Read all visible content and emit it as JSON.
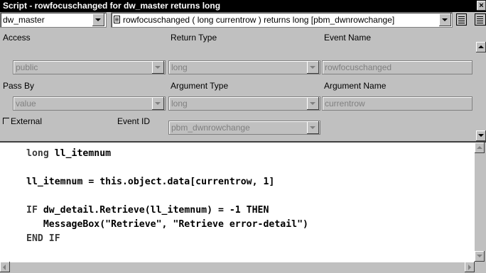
{
  "window": {
    "title": "Script - rowfocuschanged for dw_master returns long",
    "close_glyph": "×"
  },
  "toolbar": {
    "object_combo": "dw_master",
    "event_combo": "rowfocuschanged ( long currentrow )  returns long [pbm_dwnrowchange]"
  },
  "properties": {
    "access_label": "Access",
    "access_value": "public",
    "return_type_label": "Return Type",
    "return_type_value": "long",
    "event_name_label": "Event Name",
    "event_name_value": "rowfocuschanged",
    "pass_by_label": "Pass By",
    "pass_by_value": "value",
    "argument_type_label": "Argument Type",
    "argument_type_value": "long",
    "argument_name_label": "Argument Name",
    "argument_name_value": "currentrow",
    "external_label": "External",
    "event_id_label": "Event ID",
    "event_id_value": "pbm_dwnrowchange"
  },
  "script": {
    "lines": [
      {
        "kw": "long",
        "rest": " ll_itemnum"
      },
      {
        "kw": "",
        "rest": ""
      },
      {
        "kw": "",
        "rest": "ll_itemnum = this.object.data[currentrow, 1]"
      },
      {
        "kw": "",
        "rest": ""
      },
      {
        "kw": "IF",
        "rest": " dw_detail.Retrieve(ll_itemnum) = -1 THEN"
      },
      {
        "kw": "",
        "rest": "   MessageBox(\"Retrieve\", \"Retrieve error-detail\")"
      },
      {
        "kw": "END IF",
        "rest": ""
      }
    ]
  }
}
